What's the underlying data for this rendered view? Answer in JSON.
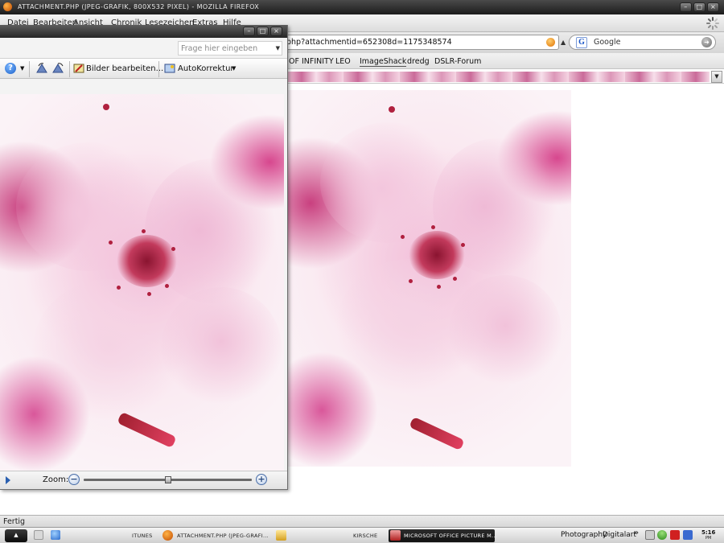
{
  "firefox": {
    "title": "ATTACHMENT.PHP (JPEG-GRAFIK, 800X532 PIXEL) - MOZILLA FIREFOX",
    "menu": [
      "Datei",
      "Bearbeiten",
      "Ansicht",
      "Chronik",
      "Lesezeichen",
      "Extras",
      "Hilfe"
    ],
    "url": "php?attachmentid=652308d=1175348574",
    "search_placeholder": "Google",
    "bookmarks": [
      "OF INFINITY",
      "LEO",
      "ImageShack",
      "dredg",
      "DSLR-Forum"
    ],
    "status": "Fertig"
  },
  "picture_manager": {
    "help_placeholder": "Frage hier eingeben",
    "toolbar": {
      "help_icon": "?",
      "edit_pictures": "Bilder bearbeiten...",
      "auto_correct": "AutoKorrektur"
    },
    "zoom_label": "Zoom:",
    "zoom_level": 0.5
  },
  "taskbar": {
    "items": [
      {
        "label": "ITUNES",
        "active": false
      },
      {
        "label": "ATTACHMENT.PHP (JPEG-GRAFI...",
        "active": false
      },
      {
        "label": "KIRSCHE",
        "active": false
      },
      {
        "label": "MICROSOFT OFFICE PICTURE M...",
        "active": true
      }
    ],
    "tray": [
      "Photography",
      "Digitalart"
    ],
    "tray_chevron": "»",
    "clock": [
      "5:16",
      "PM"
    ]
  },
  "colors": {
    "accent_pink": "#d7478e",
    "taskbar_active": "#111111"
  },
  "icons": {
    "firefox": "firefox-icon",
    "throbber": "loading-throbber-icon",
    "google": "google-icon",
    "feed": "rss-feed-icon"
  }
}
